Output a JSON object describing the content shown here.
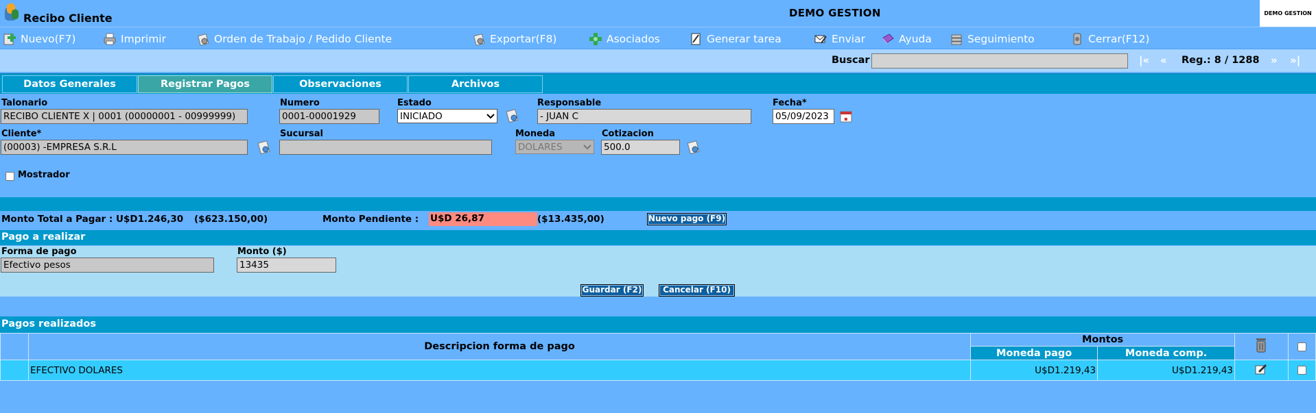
{
  "header": {
    "app_title": "Recibo Cliente",
    "company": "DEMO GESTION",
    "user_box": "DEMO GESTION"
  },
  "toolbar": {
    "items": [
      {
        "label": "Nuevo(F7)",
        "icon": "add-icon"
      },
      {
        "label": "Imprimir",
        "icon": "printer-icon"
      },
      {
        "label": "Orden de Trabajo / Pedido Cliente",
        "icon": "gear-icon"
      },
      {
        "label": "Exportar(F8)",
        "icon": "export-icon"
      },
      {
        "label": "Asociados",
        "icon": "associates-icon"
      },
      {
        "label": "Generar tarea",
        "icon": "task-icon"
      },
      {
        "label": "Enviar",
        "icon": "send-icon"
      },
      {
        "label": "Ayuda",
        "icon": "help-icon"
      },
      {
        "label": "Seguimiento",
        "icon": "tracking-icon"
      },
      {
        "label": "Cerrar(F12)",
        "icon": "close-icon"
      }
    ]
  },
  "search": {
    "label": "Buscar",
    "value": "",
    "nav_first": "|«",
    "nav_prev": "«",
    "record": "Reg.: 8 / 1288",
    "nav_next": "»",
    "nav_last": "»|"
  },
  "tabs": [
    {
      "label": "Datos Generales",
      "active": false
    },
    {
      "label": "Registrar Pagos",
      "active": true
    },
    {
      "label": "Observaciones",
      "active": false
    },
    {
      "label": "Archivos",
      "active": false
    }
  ],
  "form": {
    "talonario_label": "Talonario",
    "talonario_value": "RECIBO CLIENTE X | 0001 (00000001 - 00999999)",
    "numero_label": "Numero",
    "numero_value": "0001-00001929",
    "estado_label": "Estado",
    "estado_value": "INICIADO",
    "responsable_label": "Responsable",
    "responsable_value": "- JUAN C",
    "fecha_label": "Fecha*",
    "fecha_value": "05/09/2023",
    "cliente_label": "Cliente*",
    "cliente_value": "(00003) -EMPRESA S.R.L",
    "sucursal_label": "Sucursal",
    "sucursal_value": "",
    "moneda_label": "Moneda",
    "moneda_value": "DOLARES",
    "cotizacion_label": "Cotizacion",
    "cotizacion_value": "500.0",
    "mostrador_label": "Mostrador"
  },
  "summary": {
    "total_label": "Monto Total a Pagar : U$D1.246,30",
    "total_pesos": "($623.150,00)",
    "pendiente_label": "Monto Pendiente :",
    "pendiente_value": "U$D 26,87",
    "pendiente_pesos": "($13.435,00)",
    "nuevo_pago_button": "Nuevo pago (F9)"
  },
  "pago": {
    "section_title": "Pago a realizar",
    "forma_label": "Forma de pago",
    "forma_value": "Efectivo pesos",
    "monto_label": "Monto ($)",
    "monto_value": "13435",
    "guardar_button": "Guardar (F2)",
    "cancelar_button": "Cancelar (F10)"
  },
  "pagos_realizados": {
    "section_title": "Pagos realizados",
    "col_descripcion": "Descripcion forma de pago",
    "col_montos": "Montos",
    "col_moneda_pago": "Moneda pago",
    "col_moneda_comp": "Moneda comp.",
    "rows": [
      {
        "descripcion": "EFECTIVO DOLARES",
        "moneda_pago": "U$D1.219,43",
        "moneda_comp": "U$D1.219,43"
      }
    ]
  },
  "colors": {
    "background": "#66b2ff",
    "accent": "#0099cc",
    "active_tab": "#3aa6a6",
    "pending_highlight": "#ff8a80"
  }
}
